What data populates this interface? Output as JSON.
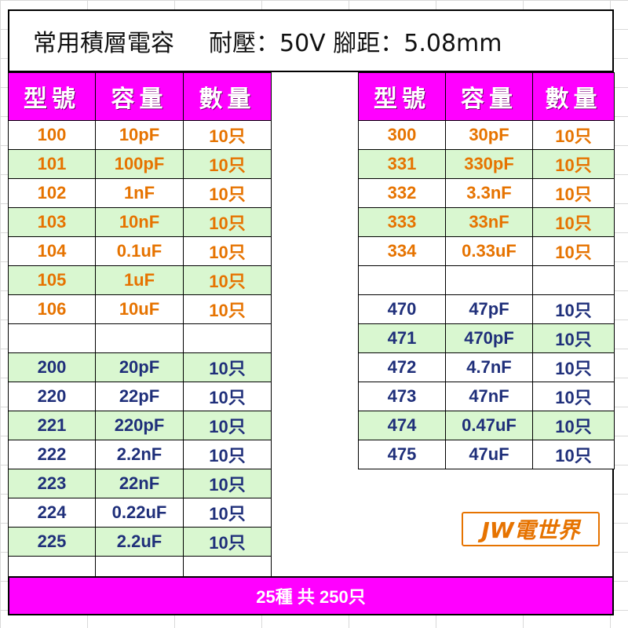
{
  "title": {
    "line1": "常用積層電容",
    "line2": "耐壓：50V 腳距：5.08mm"
  },
  "left_table": {
    "headers": [
      "型號",
      "容量",
      "數量"
    ],
    "rows": [
      {
        "model": "100",
        "capacity": "10pF",
        "qty": "10只",
        "color": "orange",
        "shade": "white"
      },
      {
        "model": "101",
        "capacity": "100pF",
        "qty": "10只",
        "color": "orange",
        "shade": "green"
      },
      {
        "model": "102",
        "capacity": "1nF",
        "qty": "10只",
        "color": "orange",
        "shade": "white"
      },
      {
        "model": "103",
        "capacity": "10nF",
        "qty": "10只",
        "color": "orange",
        "shade": "green"
      },
      {
        "model": "104",
        "capacity": "0.1uF",
        "qty": "10只",
        "color": "orange",
        "shade": "white"
      },
      {
        "model": "105",
        "capacity": "1uF",
        "qty": "10只",
        "color": "orange",
        "shade": "green"
      },
      {
        "model": "106",
        "capacity": "10uF",
        "qty": "10只",
        "color": "orange",
        "shade": "white"
      },
      {
        "model": "",
        "capacity": "",
        "qty": "",
        "color": "",
        "shade": "white"
      },
      {
        "model": "200",
        "capacity": "20pF",
        "qty": "10只",
        "color": "blue",
        "shade": "green"
      },
      {
        "model": "220",
        "capacity": "22pF",
        "qty": "10只",
        "color": "blue",
        "shade": "white"
      },
      {
        "model": "221",
        "capacity": "220pF",
        "qty": "10只",
        "color": "blue",
        "shade": "green"
      },
      {
        "model": "222",
        "capacity": "2.2nF",
        "qty": "10只",
        "color": "blue",
        "shade": "white"
      },
      {
        "model": "223",
        "capacity": "22nF",
        "qty": "10只",
        "color": "blue",
        "shade": "green"
      },
      {
        "model": "224",
        "capacity": "0.22uF",
        "qty": "10只",
        "color": "blue",
        "shade": "white"
      },
      {
        "model": "225",
        "capacity": "2.2uF",
        "qty": "10只",
        "color": "blue",
        "shade": "green"
      },
      {
        "model": "",
        "capacity": "",
        "qty": "",
        "color": "",
        "shade": "white"
      }
    ]
  },
  "right_table": {
    "headers": [
      "型號",
      "容量",
      "數量"
    ],
    "rows": [
      {
        "model": "300",
        "capacity": "30pF",
        "qty": "10只",
        "color": "orange",
        "shade": "white"
      },
      {
        "model": "331",
        "capacity": "330pF",
        "qty": "10只",
        "color": "orange",
        "shade": "green"
      },
      {
        "model": "332",
        "capacity": "3.3nF",
        "qty": "10只",
        "color": "orange",
        "shade": "white"
      },
      {
        "model": "333",
        "capacity": "33nF",
        "qty": "10只",
        "color": "orange",
        "shade": "green"
      },
      {
        "model": "334",
        "capacity": "0.33uF",
        "qty": "10只",
        "color": "orange",
        "shade": "white"
      },
      {
        "model": "",
        "capacity": "",
        "qty": "",
        "color": "",
        "shade": "white"
      },
      {
        "model": "470",
        "capacity": "47pF",
        "qty": "10只",
        "color": "blue",
        "shade": "white"
      },
      {
        "model": "471",
        "capacity": "470pF",
        "qty": "10只",
        "color": "blue",
        "shade": "green"
      },
      {
        "model": "472",
        "capacity": "4.7nF",
        "qty": "10只",
        "color": "blue",
        "shade": "white"
      },
      {
        "model": "473",
        "capacity": "47nF",
        "qty": "10只",
        "color": "blue",
        "shade": "white"
      },
      {
        "model": "474",
        "capacity": "0.47uF",
        "qty": "10只",
        "color": "blue",
        "shade": "green"
      },
      {
        "model": "475",
        "capacity": "47uF",
        "qty": "10只",
        "color": "blue",
        "shade": "white"
      }
    ]
  },
  "logo": {
    "text": "JW電世界"
  },
  "footer": {
    "text": "25種 共 250只"
  },
  "colors": {
    "header_bg": "#ff00ff",
    "row_green": "#d9f7d0",
    "orange_text": "#e67300",
    "blue_text": "#1f2f7a"
  }
}
